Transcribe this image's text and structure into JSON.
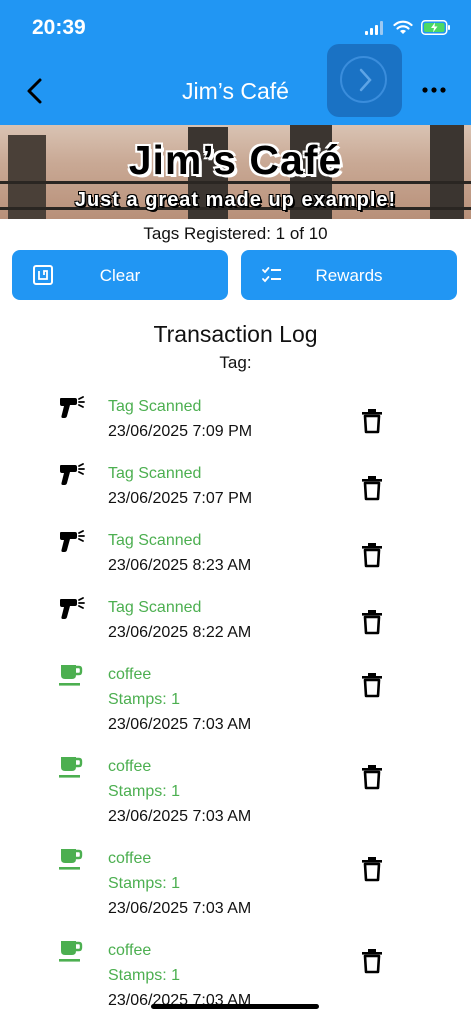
{
  "status": {
    "time": "20:39"
  },
  "header": {
    "title": "Jim’s Café"
  },
  "banner": {
    "title": "Jim’s Café",
    "subtitle": "Just a great made up example!"
  },
  "tags_registered": "Tags Registered: 1 of 10",
  "actions": {
    "clear_label": "Clear",
    "rewards_label": "Rewards"
  },
  "log": {
    "title": "Transaction Log",
    "subtitle": "Tag:",
    "items": [
      {
        "type": "scan",
        "icon": "scanner-icon",
        "title": "Tag Scanned",
        "datetime": "23/06/2025 7:09 PM"
      },
      {
        "type": "scan",
        "icon": "scanner-icon",
        "title": "Tag Scanned",
        "datetime": "23/06/2025 7:07 PM"
      },
      {
        "type": "scan",
        "icon": "scanner-icon",
        "title": "Tag Scanned",
        "datetime": "23/06/2025 8:23 AM"
      },
      {
        "type": "scan",
        "icon": "scanner-icon",
        "title": "Tag Scanned",
        "datetime": "23/06/2025 8:22 AM"
      },
      {
        "type": "stamp",
        "icon": "coffee-cup-icon",
        "title": "coffee",
        "stamps": "Stamps: 1",
        "datetime": "23/06/2025 7:03 AM"
      },
      {
        "type": "stamp",
        "icon": "coffee-cup-icon",
        "title": "coffee",
        "stamps": "Stamps: 1",
        "datetime": "23/06/2025 7:03 AM"
      },
      {
        "type": "stamp",
        "icon": "coffee-cup-icon",
        "title": "coffee",
        "stamps": "Stamps: 1",
        "datetime": "23/06/2025 7:03 AM"
      },
      {
        "type": "stamp",
        "icon": "coffee-cup-icon",
        "title": "coffee",
        "stamps": "Stamps: 1",
        "datetime": "23/06/2025 7:03 AM"
      }
    ]
  },
  "colors": {
    "primary": "#2196f3",
    "accent_green": "#4caf50",
    "text": "#111111"
  }
}
